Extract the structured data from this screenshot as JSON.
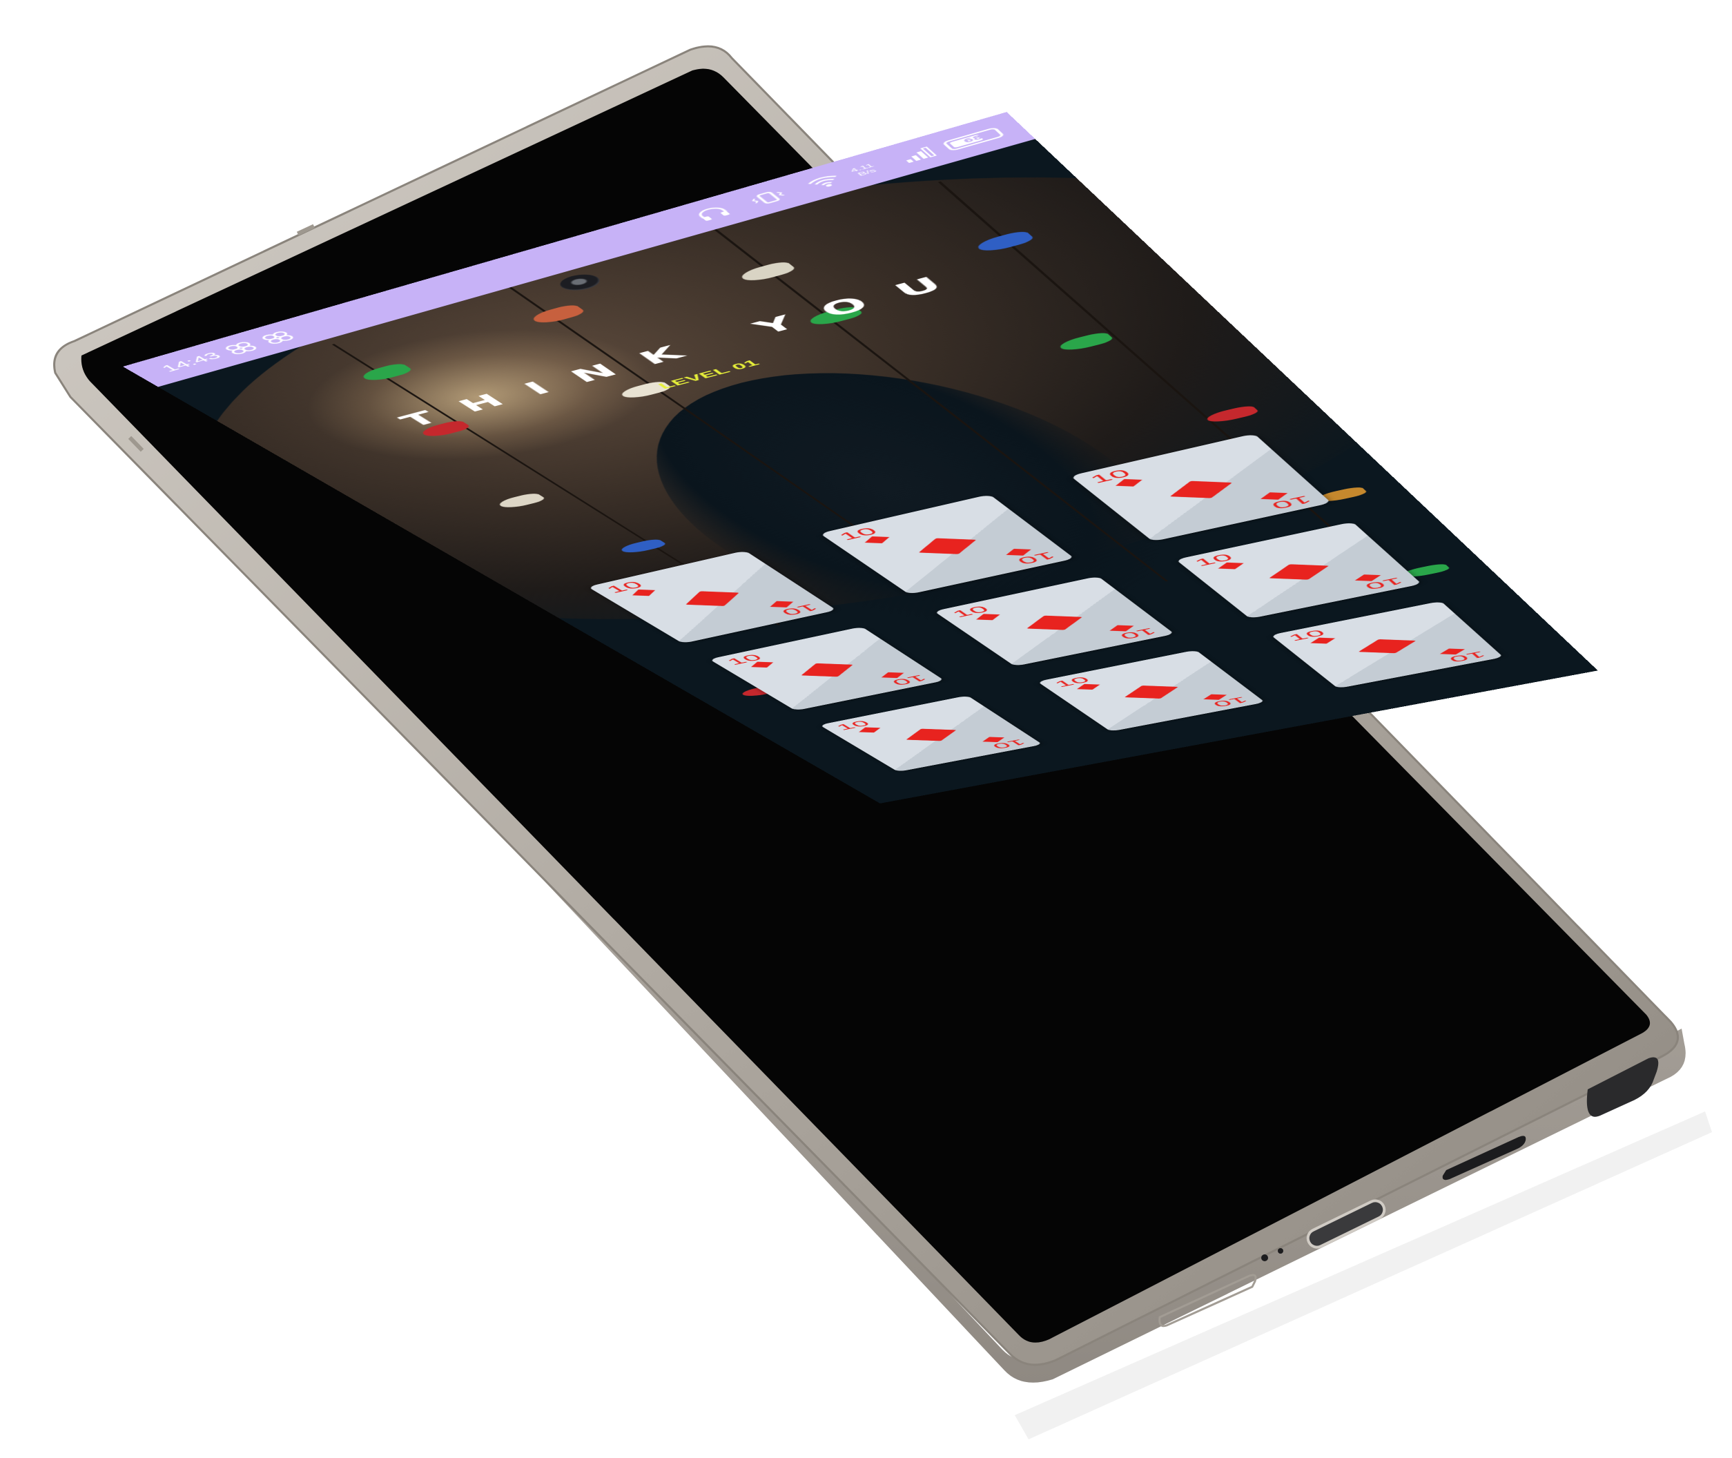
{
  "status_bar": {
    "time": "14:43",
    "left_icons": [
      "sync-icon",
      "sync-icon"
    ],
    "right_icons": [
      "headphones-icon",
      "vibrate-icon",
      "wifi-icon",
      "signal-icon"
    ],
    "net_speed_value": "4.11",
    "net_speed_unit": "B/s",
    "battery_text": "68",
    "battery_level": 0.68,
    "background_color": "#c7b2f7"
  },
  "game": {
    "title": "THINK YOU",
    "level_label": "LEVEL 01",
    "title_color": "#ffffff",
    "level_color": "#e6ef3a"
  },
  "cards": [
    {
      "rank": "10",
      "suit": "diamonds"
    },
    {
      "rank": "10",
      "suit": "diamonds"
    },
    {
      "rank": "10",
      "suit": "diamonds"
    },
    {
      "rank": "10",
      "suit": "diamonds"
    },
    {
      "rank": "10",
      "suit": "diamonds"
    },
    {
      "rank": "10",
      "suit": "diamonds"
    },
    {
      "rank": "10",
      "suit": "diamonds"
    },
    {
      "rank": "10",
      "suit": "diamonds"
    },
    {
      "rank": "10",
      "suit": "diamonds"
    }
  ],
  "colors": {
    "card_face": "#d8dee5",
    "suit_red": "#e8231f",
    "screen_background": "#0b171f",
    "device_frame": "#b9b3ab"
  }
}
